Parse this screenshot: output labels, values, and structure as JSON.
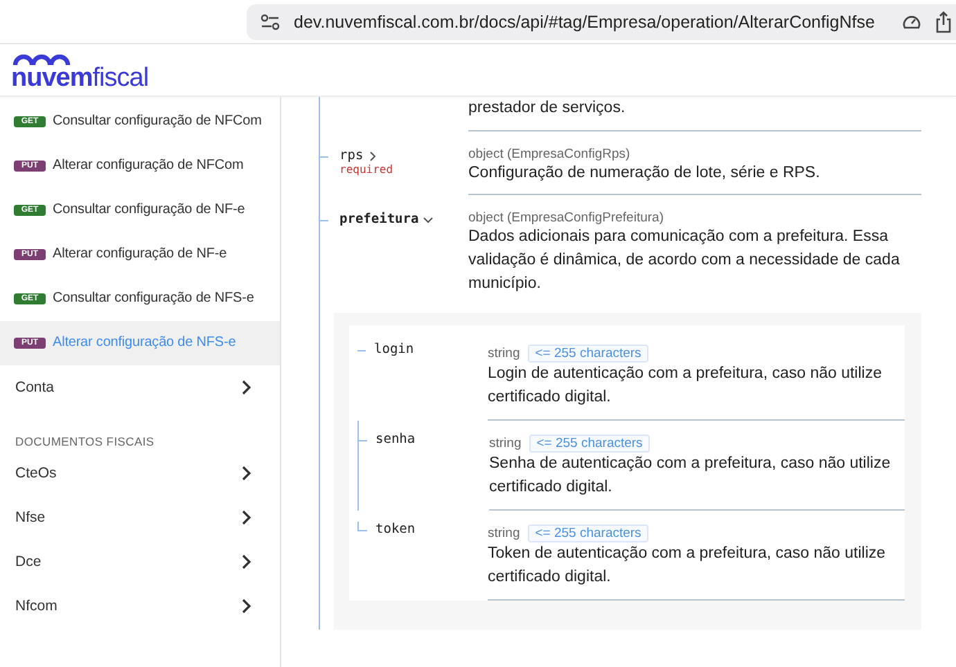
{
  "browser": {
    "url": "dev.nuvemfiscal.com.br/docs/api/#tag/Empresa/operation/AlterarConfigNfse"
  },
  "logo": {
    "text": "**nuvem**fiscal"
  },
  "sidebar": {
    "items": [
      {
        "kind": "operation",
        "method": "GET",
        "label": "Consultar configuração de NFCom",
        "selected": false
      },
      {
        "kind": "operation",
        "method": "PUT",
        "label": "Alterar configuração de NFCom",
        "selected": false
      },
      {
        "kind": "operation",
        "method": "GET",
        "label": "Consultar configuração de NF-e",
        "selected": false
      },
      {
        "kind": "operation",
        "method": "PUT",
        "label": "Alterar configuração de NF-e",
        "selected": false
      },
      {
        "kind": "operation",
        "method": "GET",
        "label": "Consultar configuração de NFS-e",
        "selected": false
      },
      {
        "kind": "operation",
        "method": "PUT",
        "label": "Alterar configuração de NFS-e",
        "selected": true
      },
      {
        "kind": "group",
        "label": "Conta",
        "selected": false
      },
      {
        "kind": "heading",
        "label": "DOCUMENTOS FISCAIS"
      },
      {
        "kind": "group",
        "label": "CteOs",
        "selected": false
      },
      {
        "kind": "group",
        "label": "Nfse",
        "selected": false
      },
      {
        "kind": "group",
        "label": "Dce",
        "selected": false
      },
      {
        "kind": "group",
        "label": "Nfcom",
        "selected": false
      }
    ]
  },
  "schema": {
    "top_fragment": "prestador de serviços.",
    "properties": [
      {
        "name": "rps",
        "required_label": "required",
        "expanded": false,
        "type": "object (EmpresaConfigRps)",
        "description": "Configuração de numeração de lote, série e RPS."
      },
      {
        "name": "prefeitura",
        "expanded": true,
        "type": "object (EmpresaConfigPrefeitura)",
        "description": "Dados adicionais para comunicação com a prefeitura. Essa validação é dinâmica, de acordo com a necessidade de cada município.",
        "children": [
          {
            "name": "login",
            "type": "string",
            "constraint": "<= 255 characters",
            "description": "Login de autenticação com a prefeitura, caso não utilize certificado digital."
          },
          {
            "name": "senha",
            "type": "string",
            "constraint": "<= 255 characters",
            "description": "Senha de autenticação com a prefeitura, caso não utilize certificado digital."
          },
          {
            "name": "token",
            "type": "string",
            "constraint": "<= 255 characters",
            "description": "Token de autenticação com a prefeitura, caso não utilize certificado digital."
          }
        ]
      }
    ]
  }
}
